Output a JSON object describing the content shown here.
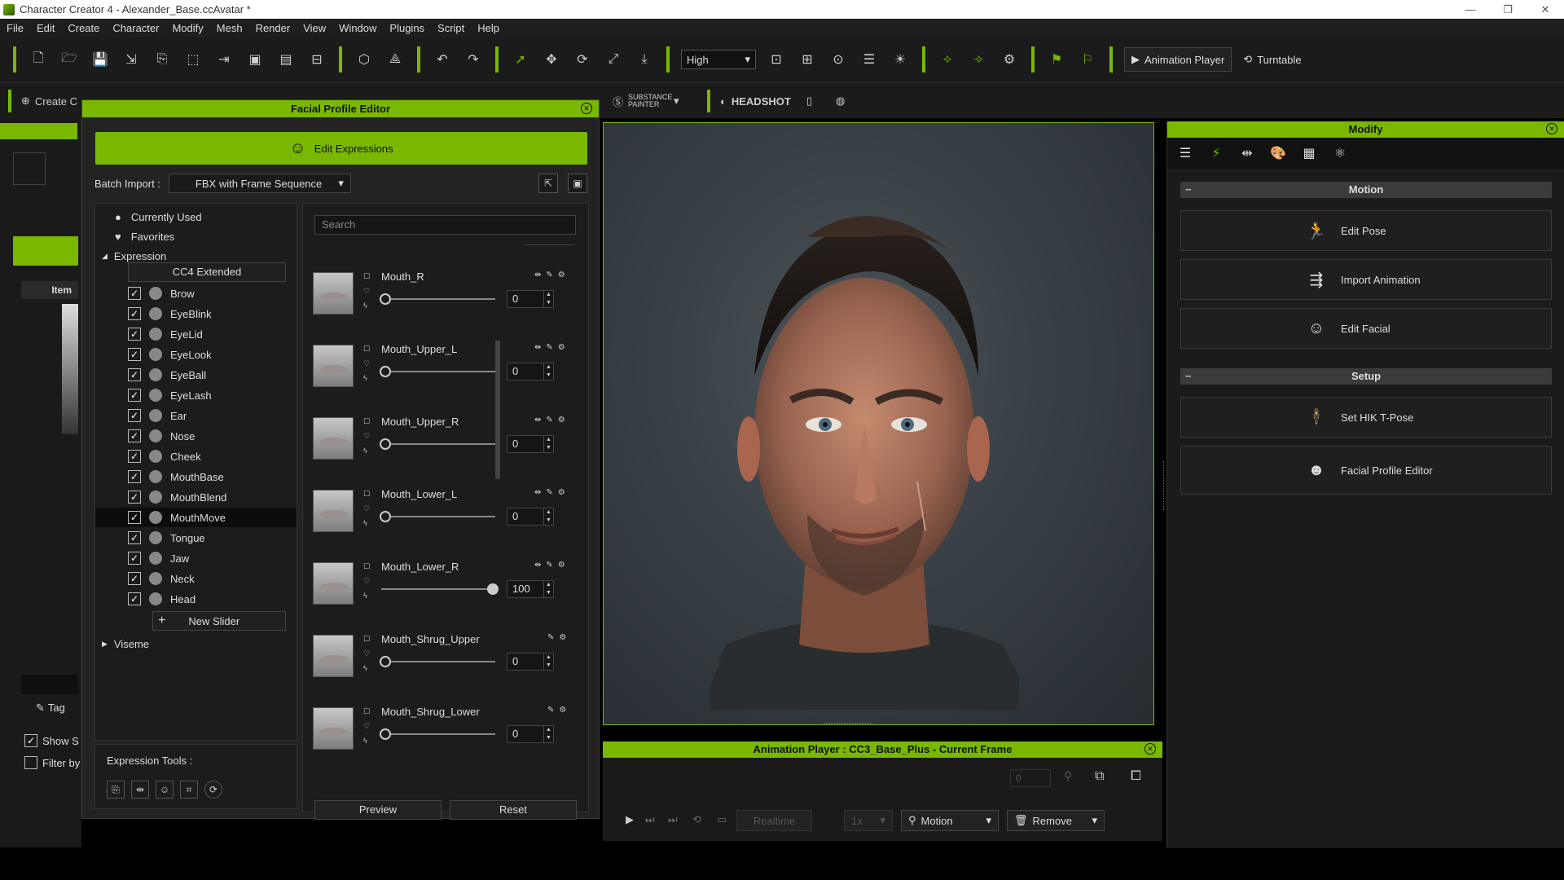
{
  "window": {
    "title": "Character Creator 4 - Alexander_Base.ccAvatar *"
  },
  "menu": [
    "File",
    "Edit",
    "Create",
    "Character",
    "Modify",
    "Mesh",
    "Render",
    "View",
    "Window",
    "Plugins",
    "Script",
    "Help"
  ],
  "toolbar": {
    "quality_value": "High",
    "animation_player": "Animation Player",
    "turntable": "Turntable"
  },
  "toolbar2": {
    "create_label": "Create C",
    "substance_painter": "SUBSTANCE PAINTER",
    "headshot": "HEADSHOT"
  },
  "facial_profile_editor": {
    "title": "Facial Profile Editor",
    "edit_expressions": "Edit Expressions",
    "batch_import_label": "Batch Import :",
    "batch_import_value": "FBX with Frame Sequence",
    "tree": {
      "currently_used": "Currently Used",
      "favorites": "Favorites",
      "expression": "Expression",
      "cc4_extended": "CC4 Extended",
      "categories": [
        "Brow",
        "EyeBlink",
        "EyeLid",
        "EyeLook",
        "EyeBall",
        "EyeLash",
        "Ear",
        "Nose",
        "Cheek",
        "MouthBase",
        "MouthBlend",
        "MouthMove",
        "Tongue",
        "Jaw",
        "Neck",
        "Head"
      ],
      "selected": "MouthMove",
      "new_slider": "New Slider",
      "viseme": "Viseme"
    },
    "expression_tools_label": "Expression Tools :",
    "search_placeholder": "Search",
    "sliders": [
      {
        "name": "Mouth_R",
        "value": "0"
      },
      {
        "name": "Mouth_Upper_L",
        "value": "0"
      },
      {
        "name": "Mouth_Upper_R",
        "value": "0"
      },
      {
        "name": "Mouth_Lower_L",
        "value": "0"
      },
      {
        "name": "Mouth_Lower_R",
        "value": "100"
      },
      {
        "name": "Mouth_Shrug_Upper",
        "value": "0"
      },
      {
        "name": "Mouth_Shrug_Lower",
        "value": "0"
      }
    ],
    "preview": "Preview",
    "reset": "Reset"
  },
  "left_panel": {
    "item_header": "Item",
    "tag": "Tag",
    "show": "Show S",
    "filter": "Filter by"
  },
  "animation_player": {
    "title": "Animation Player : CC3_Base_Plus - Current Frame",
    "frame": "0",
    "realtime": "Realtime",
    "speed": "1x",
    "motion": "Motion",
    "remove": "Remove"
  },
  "modify": {
    "title": "Modify",
    "section_motion": "Motion",
    "edit_pose": "Edit Pose",
    "import_animation": "Import Animation",
    "edit_facial": "Edit Facial",
    "section_setup": "Setup",
    "set_hik": "Set HIK T-Pose",
    "facial_profile_editor": "Facial Profile Editor"
  },
  "colors": {
    "accent": "#7ab800",
    "bg": "#1b1b1b"
  }
}
